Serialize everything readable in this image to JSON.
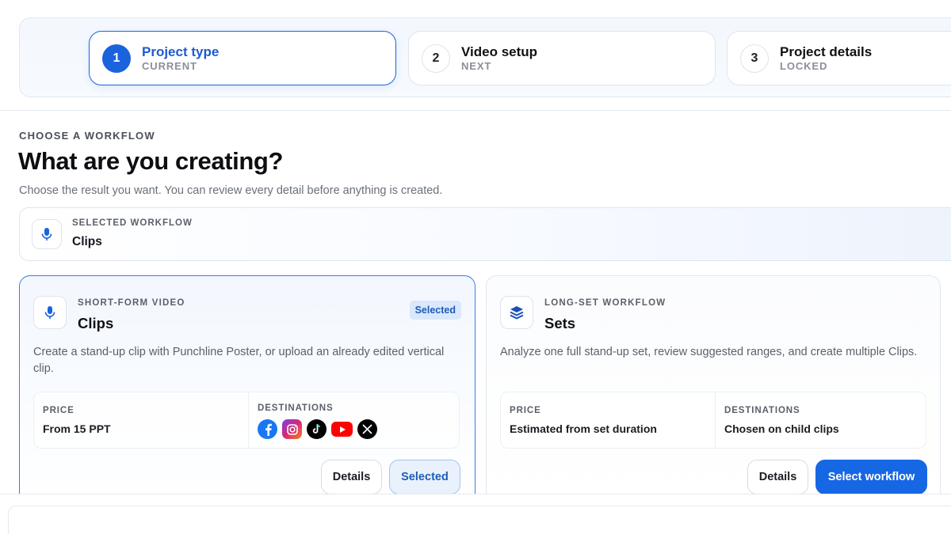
{
  "stepper": {
    "steps": [
      {
        "num": "1",
        "title": "Project type",
        "status": "CURRENT"
      },
      {
        "num": "2",
        "title": "Video setup",
        "status": "NEXT"
      },
      {
        "num": "3",
        "title": "Project details",
        "status": "LOCKED"
      }
    ]
  },
  "header": {
    "eyebrow": "CHOOSE A WORKFLOW",
    "title": "What are you creating?",
    "description": "Choose the result you want. You can review every detail before anything is created."
  },
  "selected_workflow": {
    "label": "SELECTED WORKFLOW",
    "value": "Clips",
    "icon": "microphone-icon"
  },
  "cards": {
    "clips": {
      "icon": "microphone-icon",
      "eyebrow": "SHORT-FORM VIDEO",
      "title": "Clips",
      "badge": "Selected",
      "description": "Create a stand-up clip with Punchline Poster, or upload an already edited vertical clip.",
      "price_label": "PRICE",
      "price_value": "From 15 PPT",
      "destinations_label": "DESTINATIONS",
      "destinations": [
        "facebook-icon",
        "instagram-icon",
        "tiktok-icon",
        "youtube-icon",
        "x-icon"
      ],
      "details_button": "Details",
      "action_button": "Selected"
    },
    "sets": {
      "icon": "layers-icon",
      "eyebrow": "LONG-SET WORKFLOW",
      "title": "Sets",
      "description": "Analyze one full stand-up set, review suggested ranges, and create multiple Clips.",
      "price_label": "PRICE",
      "price_value": "Estimated from set duration",
      "destinations_label": "DESTINATIONS",
      "destinations_value": "Chosen on child clips",
      "details_button": "Details",
      "action_button": "Select workflow"
    }
  },
  "colors": {
    "accent": "#1b63dd",
    "primary_button": "#1667e3",
    "badge_bg": "#d9e8fb",
    "badge_text": "#1f5cb8"
  }
}
